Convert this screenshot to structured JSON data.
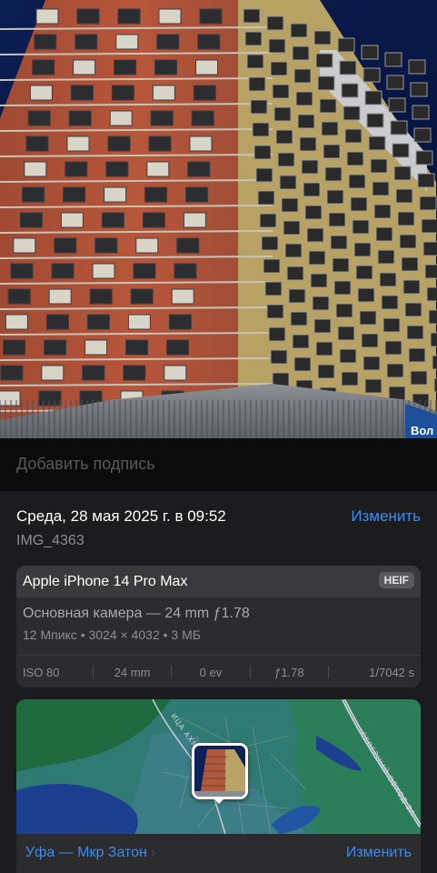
{
  "photo": {
    "alt": "",
    "sign_text": "Вол"
  },
  "caption": {
    "placeholder": "Добавить подпись"
  },
  "info": {
    "datetime": "Среда, 28 мая 2025 г. в 09:52",
    "edit_label": "Изменить",
    "filename": "IMG_4363"
  },
  "camera": {
    "device": "Apple iPhone 14 Pro Max",
    "format": "HEIF",
    "lens": "Основная камера — 24 mm ƒ1.78",
    "specs": "12 Мпикс • 3024 × 4032 • 3 МБ",
    "exif": {
      "iso": "ISO 80",
      "focal": "24 mm",
      "ev": "0 ev",
      "aperture": "ƒ1.78",
      "shutter": "1/7042 s"
    }
  },
  "map": {
    "street_label_1": "ИЦА АХМЕТ",
    "street_label_2": "СЕВЕРНЫЙ ОБХОД ЗА",
    "location": "Уфа — Мкр Затон",
    "chevron": "›",
    "edit_label": "Изменить"
  },
  "colors": {
    "accent": "#3b8cf0",
    "background": "#1c1c1e",
    "card": "#2c2c2e"
  }
}
